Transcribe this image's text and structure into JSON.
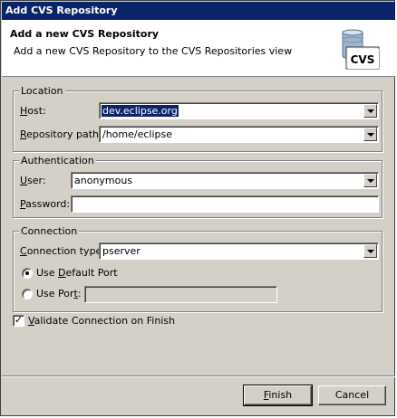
{
  "window": {
    "title": "Add CVS Repository"
  },
  "banner": {
    "title": "Add a new CVS Repository",
    "description": "Add a new CVS Repository to the CVS Repositories view",
    "icon_label": "CVS"
  },
  "location": {
    "group_label": "Location",
    "host_label_pre": "",
    "host_label_mn": "H",
    "host_label_post": "ost:",
    "host_value": "dev.eclipse.org",
    "path_label_pre": "",
    "path_label_mn": "R",
    "path_label_post": "epository path:",
    "path_value": "/home/eclipse"
  },
  "authentication": {
    "group_label": "Authentication",
    "user_label_pre": "",
    "user_label_mn": "U",
    "user_label_post": "ser:",
    "user_value": "anonymous",
    "password_label_pre": "",
    "password_label_mn": "P",
    "password_label_post": "assword:",
    "password_value": ""
  },
  "connection": {
    "group_label": "Connection",
    "type_label_pre": "",
    "type_label_mn": "C",
    "type_label_post": "onnection type:",
    "type_value": "pserver",
    "default_port_pre": "Use ",
    "default_port_mn": "D",
    "default_port_post": "efault Port",
    "use_port_pre": "Use Por",
    "use_port_mn": "t",
    "use_port_post": ":",
    "port_value": ""
  },
  "validate": {
    "label_pre": "",
    "label_mn": "V",
    "label_post": "alidate Connection on Finish",
    "checked_mark": "✓"
  },
  "buttons": {
    "finish_pre": "",
    "finish_mn": "F",
    "finish_post": "inish",
    "cancel": "Cancel"
  }
}
